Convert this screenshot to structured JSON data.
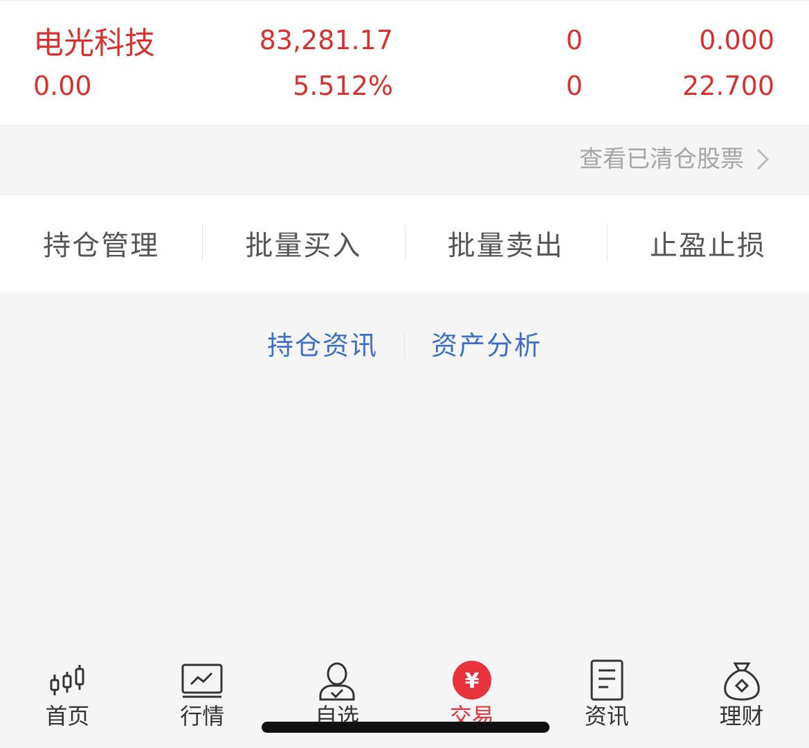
{
  "holding": {
    "name": "电光科技",
    "row1": [
      "83,281.17",
      "0",
      "0.000"
    ],
    "row2": [
      "0.00",
      "5.512%",
      "0",
      "22.700"
    ]
  },
  "cleared_link": "查看已清仓股票",
  "actions": [
    "持仓管理",
    "批量买入",
    "批量卖出",
    "止盈止损"
  ],
  "info_links": [
    "持仓资讯",
    "资产分析"
  ],
  "tabs": [
    {
      "label": "首页",
      "icon": "candlestick-icon"
    },
    {
      "label": "行情",
      "icon": "market-chart-icon"
    },
    {
      "label": "自选",
      "icon": "watchlist-person-icon"
    },
    {
      "label": "交易",
      "icon": "yuan-trade-icon",
      "glyph": "¥"
    },
    {
      "label": "资讯",
      "icon": "news-document-icon"
    },
    {
      "label": "理财",
      "icon": "money-bag-icon"
    }
  ],
  "colors": {
    "price_red": "#d9322e",
    "link_blue": "#3b6fc9",
    "active_red": "#e8323c"
  }
}
